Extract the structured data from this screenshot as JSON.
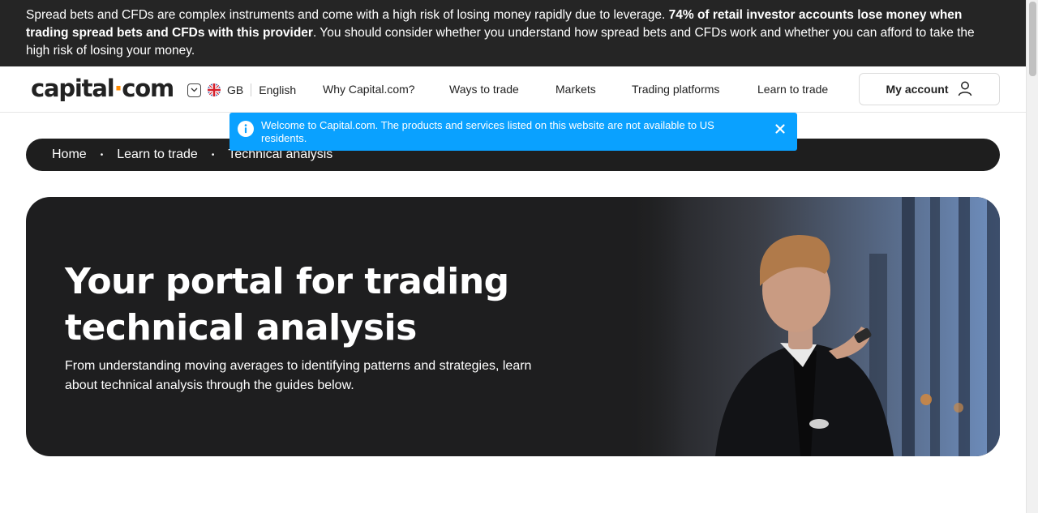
{
  "risk_warning": {
    "text_start": "Spread bets and CFDs are complex instruments and come with a high risk of losing money rapidly due to leverage. ",
    "text_bold": "74% of retail investor accounts lose money when trading spread bets and CFDs with this provider",
    "text_end": ". You should consider whether you understand how spread bets and CFDs work and whether you can afford to take the high risk of losing your money."
  },
  "header": {
    "logo_left": "capital",
    "logo_dot": "·",
    "logo_right": "com",
    "region": "GB",
    "language": "English",
    "nav": [
      "Why Capital.com?",
      "Ways to trade",
      "Markets",
      "Trading platforms",
      "Learn to trade"
    ],
    "account_label": "My account"
  },
  "notice": {
    "message": "Welcome to Capital.com. The products and services listed on this website are not available to US residents."
  },
  "breadcrumb": {
    "items": [
      "Home",
      "Learn to trade",
      "Technical analysis"
    ],
    "separator": "•"
  },
  "hero": {
    "title": "Your portal for trading technical analysis",
    "subtitle": "From understanding moving averages to identifying patterns and strategies, learn about technical analysis through the guides below."
  },
  "colors": {
    "brand_accent": "#ff8a00",
    "notice_blue": "#0aa1ff",
    "dark_bg": "#1e1e1e"
  },
  "icons": [
    "chevron-down-icon",
    "uk-flag-icon",
    "user-icon",
    "info-icon",
    "close-icon"
  ]
}
